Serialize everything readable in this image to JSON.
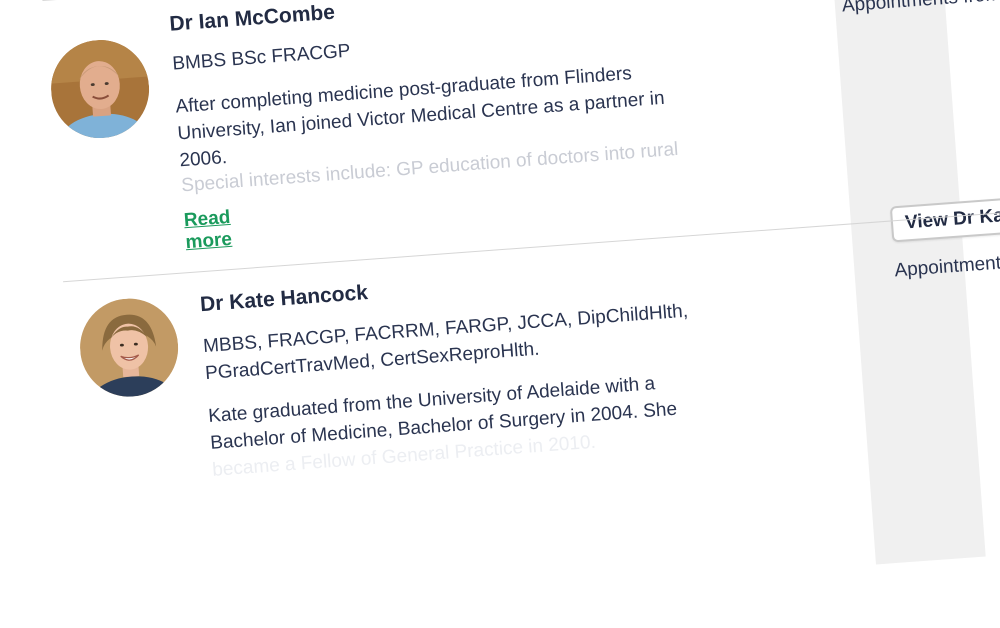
{
  "doctors": [
    {
      "name": "Dr Ian McCombe",
      "qualifications": "BMBS BSc FRACGP",
      "bio": "After completing medicine post-graduate from Flinders University, Ian joined Victor Medical Centre as a partner in 2006.",
      "bio_faded": "Special interests include: GP education of doctors into rural",
      "read_more": "Read more",
      "appointments": "Appointments from",
      "view_button": "View Dr Ka"
    },
    {
      "name": "Dr Kate Hancock",
      "qualifications": "MBBS, FRACGP, FACRRM, FARGP, JCCA, DipChildHlth, PGradCertTravMed, CertSexReproHlth.",
      "bio": "Kate graduated from the University of Adelaide with a Bachelor of Medicine, Bachelor of Surgery in 2004. She",
      "bio_faded": "became a Fellow of General Practice in 2010.",
      "appointments": "Appointments f"
    }
  ]
}
